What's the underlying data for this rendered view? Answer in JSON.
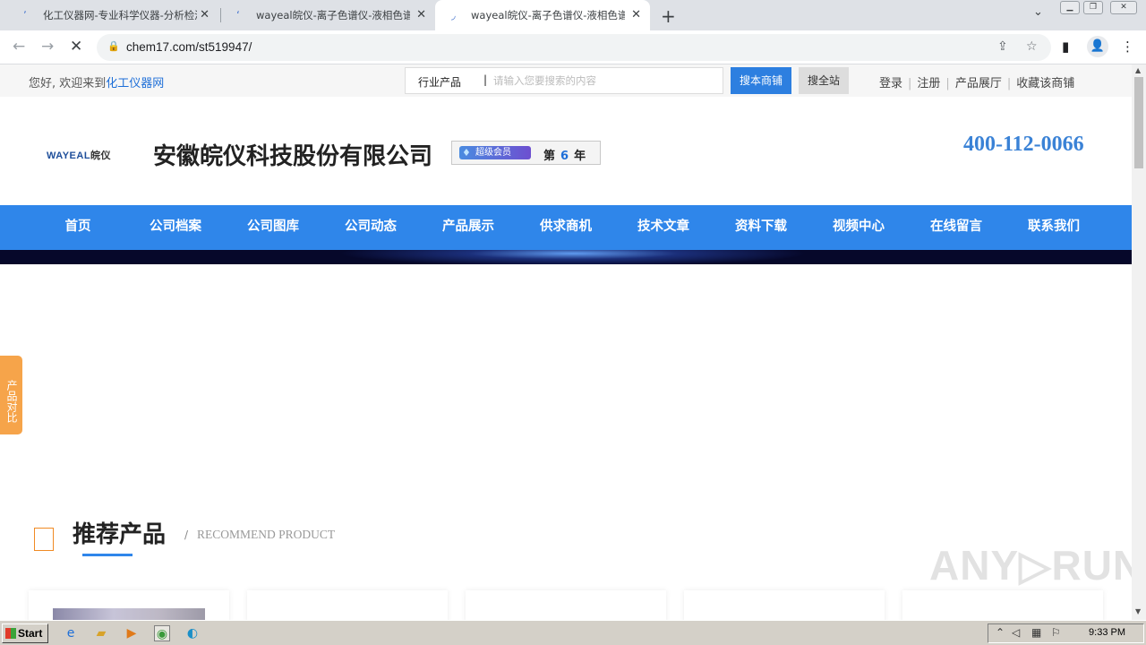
{
  "browser": {
    "tabs": [
      {
        "title": "化工仪器网-专业科学仪器-分析检测",
        "active": false
      },
      {
        "title": "wayeal皖仪-离子色谱仪-液相色谱仪",
        "active": false
      },
      {
        "title": "wayeal皖仪-离子色谱仪-液相色谱仪",
        "active": true
      }
    ],
    "tab_close": "✕",
    "new_tab": "+",
    "url": "chem17.com/st519947/",
    "icons": {
      "back": "←",
      "forward": "→",
      "reload": "✕",
      "lock": "🔒",
      "share": "⇪",
      "star": "☆",
      "sidepanel": "▮",
      "profile": "👤",
      "menu": "⋮",
      "tab_search": "⌄",
      "minimize": "▁",
      "restore": "❐",
      "close": "✕"
    }
  },
  "site": {
    "welcome_prefix": "您好, 欢迎来到",
    "welcome_link": "化工仪器网",
    "search": {
      "category": "行业产品",
      "pipe": "|",
      "placeholder": "请输入您要搜索的内容",
      "btn_shop": "搜本商铺",
      "btn_all": "搜全站"
    },
    "toplinks": [
      "登录",
      "注册",
      "产品展厅",
      "收藏该商铺"
    ],
    "logo_text_a": "WAYEAL",
    "logo_text_b": "皖仪",
    "company_name": "安徽皖仪科技股份有限公司",
    "member": {
      "badge": "超级会员",
      "gem": "♦",
      "prefix": "第",
      "years": "6",
      "suffix": "年"
    },
    "phone": "400-112-0066",
    "nav": [
      "首页",
      "公司档案",
      "公司图库",
      "公司动态",
      "产品展示",
      "供求商机",
      "技术文章",
      "资料下载",
      "视频中心",
      "在线留言",
      "联系我们"
    ],
    "side_compare": "产品对比",
    "section": {
      "title": "推荐产品",
      "slash": "/",
      "subtitle": "RECOMMEND PRODUCT"
    },
    "watermark": "ANY▷RUN"
  },
  "taskbar": {
    "start": "Start",
    "clock": "9:33 PM",
    "apps": [
      "ie-icon",
      "folder-icon",
      "media-icon",
      "chrome-icon",
      "edge-icon"
    ]
  }
}
